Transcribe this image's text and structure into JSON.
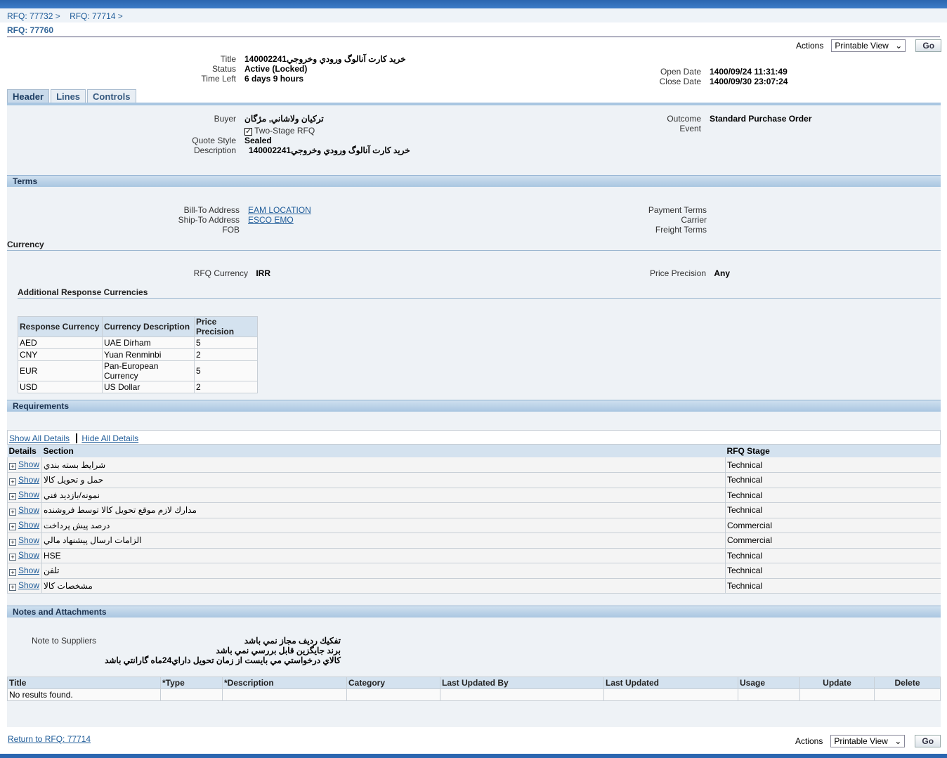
{
  "breadcrumbs": [
    "RFQ: 77732",
    "RFQ: 77714"
  ],
  "page_title": "RFQ: 77760",
  "actions": {
    "label": "Actions",
    "select": "Printable View",
    "go": "Go"
  },
  "summary": {
    "title_label": "Title",
    "title": "خريد كارت آنالوگ ورودي وخروجي140002241",
    "status_label": "Status",
    "status": "Active (Locked)",
    "time_left_label": "Time Left",
    "time_left": "6 days 9 hours",
    "open_label": "Open Date",
    "open_date": "1400/09/24 11:31:49",
    "close_label": "Close Date",
    "close_date": "1400/09/30 23:07:24"
  },
  "tabs": [
    "Header",
    "Lines",
    "Controls"
  ],
  "header": {
    "buyer_label": "Buyer",
    "buyer": "تركيان ولاشاني, مژگان",
    "two_stage": "Two-Stage RFQ",
    "quote_style_label": "Quote Style",
    "quote_style": "Sealed",
    "description_label": "Description",
    "description": "خريد كارت آنالوگ ورودي وخروجي140002241",
    "outcome_label": "Outcome",
    "outcome": "Standard Purchase Order",
    "event_label": "Event"
  },
  "terms": {
    "heading": "Terms",
    "bill_to_label": "Bill-To Address",
    "bill_to": "EAM LOCATION",
    "ship_to_label": "Ship-To Address",
    "ship_to": "ESCO EMO",
    "fob_label": "FOB",
    "payment_label": "Payment Terms",
    "carrier_label": "Carrier",
    "freight_label": "Freight Terms"
  },
  "currency": {
    "heading": "Currency",
    "rfq_currency_label": "RFQ Currency",
    "rfq_currency": "IRR",
    "precision_label": "Price Precision",
    "precision": "Any",
    "additional_heading": "Additional Response Currencies",
    "columns": [
      "Response Currency",
      "Currency Description",
      "Price Precision"
    ],
    "rows": [
      [
        "AED",
        "UAE Dirham",
        "5"
      ],
      [
        "CNY",
        "Yuan Renminbi",
        "2"
      ],
      [
        "EUR",
        "Pan-European Currency",
        "5"
      ],
      [
        "USD",
        "US Dollar",
        "2"
      ]
    ]
  },
  "requirements": {
    "heading": "Requirements",
    "show_all": "Show All Details",
    "hide_all": "Hide All Details",
    "columns": [
      "Details",
      "Section",
      "RFQ Stage"
    ],
    "show_label": "Show",
    "rows": [
      [
        "شرايط بسته بندي",
        "Technical"
      ],
      [
        "حمل و تحويل كالا",
        "Technical"
      ],
      [
        "نمونه/بازديد فني",
        "Technical"
      ],
      [
        "مدارك لازم موقع تحويل كالا توسط فروشنده",
        "Technical"
      ],
      [
        "درصد پيش پرداخت",
        "Commercial"
      ],
      [
        "الزامات ارسال پيشنهاد مالي",
        "Commercial"
      ],
      [
        "HSE",
        "Technical"
      ],
      [
        "تلفن",
        "Technical"
      ],
      [
        "مشخصات كالا",
        "Technical"
      ]
    ]
  },
  "notes": {
    "heading": "Notes and Attachments",
    "note_label": "Note to Suppliers",
    "lines": [
      "تفكيك رديف مجاز نمي باشد",
      "برند جايگزين قابل بررسي نمي باشد",
      "كالاي درخواستي مي بايست از زمان تحويل  داراي24ماه گارانتي باشد"
    ],
    "columns": [
      "Title",
      "*Type",
      "*Description",
      "Category",
      "Last Updated By",
      "Last Updated",
      "Usage",
      "Update",
      "Delete"
    ],
    "empty": "No results found."
  },
  "return_link": "Return to RFQ: 77714"
}
